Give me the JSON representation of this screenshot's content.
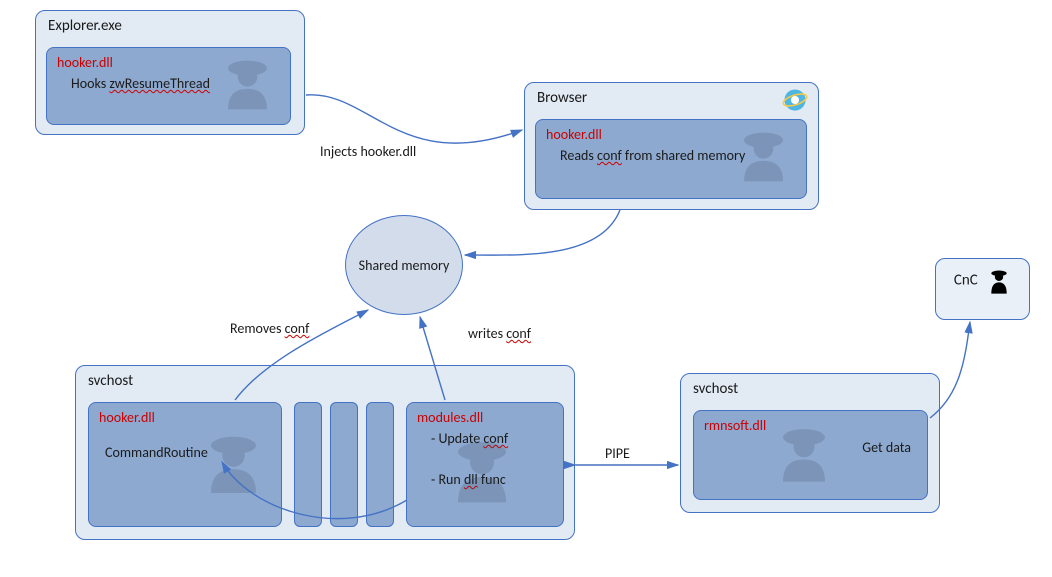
{
  "explorer": {
    "title": "Explorer.exe",
    "module": {
      "name": "hooker.dll",
      "line1_a": "Hooks ",
      "line1_b": "zwResumeThread"
    }
  },
  "browser": {
    "title": "Browser",
    "module": {
      "name": "hooker.dll",
      "line1_a": "Reads ",
      "line1_b": "conf",
      "line1_c": " from shared memory"
    }
  },
  "shared_memory": {
    "label": "Shared memory"
  },
  "svchost1": {
    "title": "svchost",
    "hooker": {
      "name": "hooker.dll",
      "line1": "CommandRoutine"
    },
    "modules": {
      "name": "modules.dll",
      "line1_a": "- Update ",
      "line1_b": "conf",
      "line2_a": "- Run ",
      "line2_b": "dll",
      "line2_c": " func"
    }
  },
  "svchost2": {
    "title": "svchost",
    "rmnsoft": {
      "name": "rmnsoft.dll",
      "line1": "Get data"
    }
  },
  "cnc": {
    "label": "CnC"
  },
  "edges": {
    "injects": "Injects hooker.dll",
    "removes_a": "Removes ",
    "removes_b": "conf",
    "writes_a": "writes ",
    "writes_b": "conf",
    "pipe": "PIPE"
  }
}
